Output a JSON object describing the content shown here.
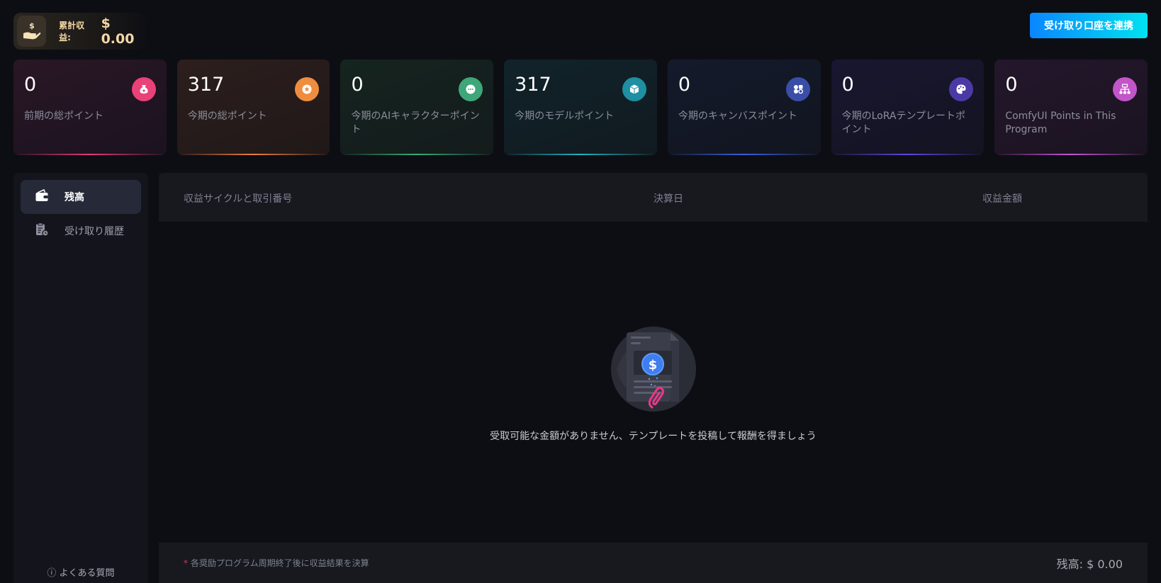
{
  "header": {
    "earnings_label": "累計収益:",
    "earnings_value": "$ 0.00",
    "link_account_button": "受け取り口座を連携"
  },
  "stats": [
    {
      "value": "0",
      "label": "前期の総ポイント",
      "icon": "money-bag-icon",
      "color": "#e84279"
    },
    {
      "value": "317",
      "label": "今期の総ポイント",
      "icon": "star-badge-icon",
      "color": "#ef8d3f"
    },
    {
      "value": "0",
      "label": "今期のAIキャラクターポイント",
      "icon": "chat-bubble-icon",
      "color": "#3fa67a"
    },
    {
      "value": "317",
      "label": "今期のモデルポイント",
      "icon": "cube-icon",
      "color": "#1f8fa3"
    },
    {
      "value": "0",
      "label": "今期のキャンバスポイント",
      "icon": "shapes-icon",
      "color": "#3a4ea8"
    },
    {
      "value": "0",
      "label": "今期のLoRAテンプレートポイント",
      "icon": "palette-icon",
      "color": "#4b3aa6"
    },
    {
      "value": "0",
      "label": "ComfyUI Points in This Program",
      "icon": "hierarchy-icon",
      "color": "#c255c8"
    }
  ],
  "sidebar": {
    "items": [
      {
        "label": "残高",
        "icon": "wallet-icon",
        "active": true
      },
      {
        "label": "受け取り履歴",
        "icon": "history-clipboard-icon",
        "active": false
      }
    ],
    "faq": "ⓘ よくある質問"
  },
  "table": {
    "columns": [
      "収益サイクルと取引番号",
      "決算日",
      "収益金額"
    ],
    "empty_message": "受取可能な金額がありません、テンプレートを投稿して報酬を得ましょう",
    "empty_icon": "document-dollar-icon"
  },
  "footer": {
    "note_star": "*",
    "note": "各奨励プログラム周期終了後に収益結果を決算",
    "balance": "残高: $ 0.00"
  }
}
